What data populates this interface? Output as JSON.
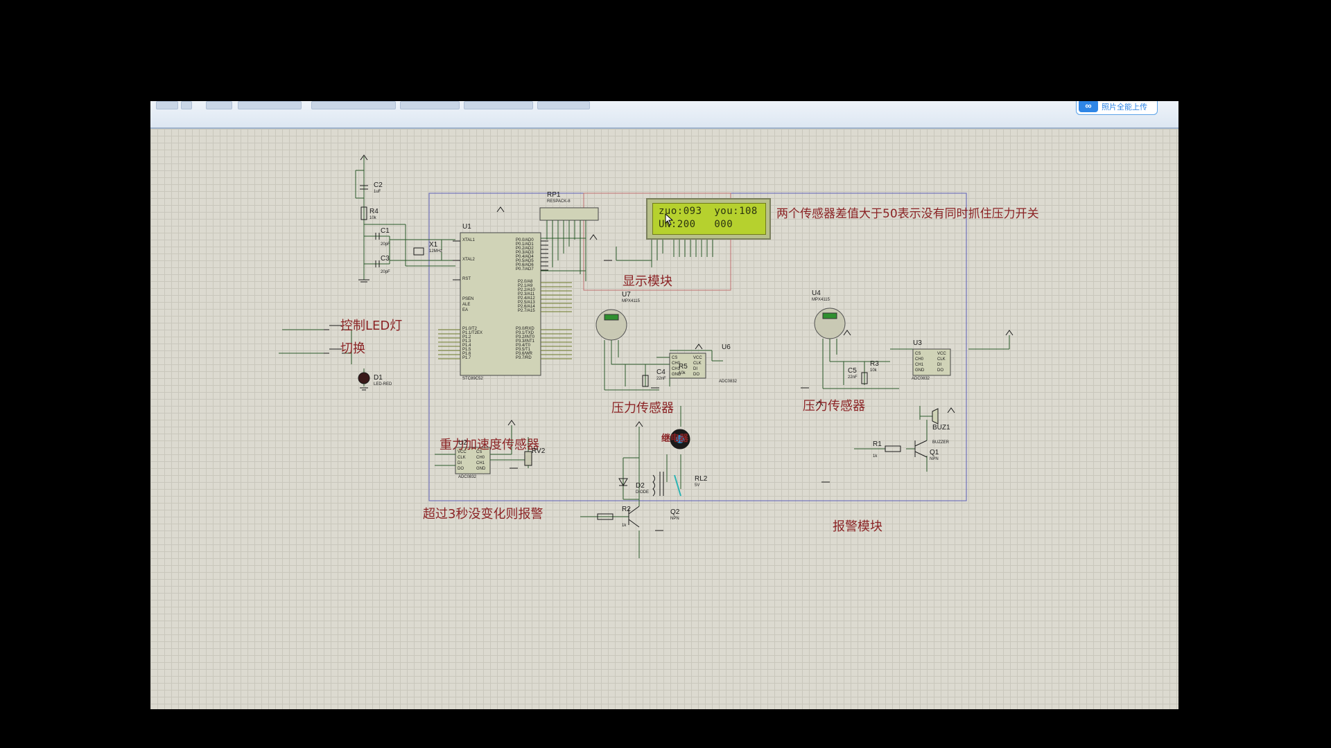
{
  "toolbar": {
    "upload_label": "照片全能上传",
    "upload_icon": "infinity-icon"
  },
  "lcd": {
    "line1": "zuo:093  you:108",
    "line2": "UN:200   000"
  },
  "annotations": {
    "diff_note": "两个传感器差值大于50表示没有同时抓住压力开关",
    "display_module": "显示模块",
    "led_control": "控制LED灯",
    "switch": "切换",
    "pressure_sensor_left": "压力传感器",
    "pressure_sensor_right": "压力传感器",
    "gravity_sensor": "重力加速度传感器",
    "timeout_alarm": "超过3秒没变化则报警",
    "relay": "继电器",
    "alarm_module": "报警模块"
  },
  "components": {
    "u1": {
      "ref": "U1",
      "type": "STC89C52"
    },
    "rp1": {
      "ref": "RP1",
      "type": "RESPACK-8"
    },
    "c1": {
      "ref": "C1",
      "value": "20pF"
    },
    "c2": {
      "ref": "C2",
      "value": "1uF"
    },
    "c3": {
      "ref": "C3",
      "value": "20pF"
    },
    "r4": {
      "ref": "R4",
      "value": "10k"
    },
    "x1": {
      "ref": "X1",
      "value": "12MHz"
    },
    "d1": {
      "ref": "D1",
      "value": "LED-RED"
    },
    "u7": {
      "ref": "U7",
      "value": "MPX4115"
    },
    "u4": {
      "ref": "U4",
      "value": "MPX4115"
    },
    "u6": {
      "ref": "U6",
      "value": "ADC0832"
    },
    "u3": {
      "ref": "U3",
      "value": "ADC0832"
    },
    "u2": {
      "ref": "U2",
      "value": "ADC0832"
    },
    "c4": {
      "ref": "C4",
      "value": "22nF"
    },
    "c5": {
      "ref": "C5",
      "value": "22nF"
    },
    "r5": {
      "ref": "R5",
      "value": "10k"
    },
    "r3": {
      "ref": "R3",
      "value": "10k"
    },
    "rv2": {
      "ref": "RV2"
    },
    "d2": {
      "ref": "D2",
      "value": "DIODE"
    },
    "rl2": {
      "ref": "RL2",
      "value": "5V"
    },
    "q2": {
      "ref": "Q2",
      "value": "NPN"
    },
    "r2": {
      "ref": "R2",
      "value": "1k"
    },
    "buz1": {
      "ref": "BUZ1",
      "value": "BUZZER"
    },
    "r1": {
      "ref": "R1",
      "value": "1k"
    },
    "q1": {
      "ref": "Q1",
      "value": "NPN"
    }
  },
  "u1_pins_left": [
    "XTAL1",
    "XTAL2",
    "RST",
    "PSEN",
    "ALE",
    "EA",
    "P1.0/T2",
    "P1.1/T2EX",
    "P1.2",
    "P1.3",
    "P1.4",
    "P1.5",
    "P1.6",
    "P1.7"
  ],
  "u1_pins_right": [
    "P0.0/AD0",
    "P0.1/AD1",
    "P0.2/AD2",
    "P0.3/AD3",
    "P0.4/AD4",
    "P0.5/AD5",
    "P0.6/AD6",
    "P0.7/AD7",
    "P2.0/A8",
    "P2.1/A9",
    "P2.2/A10",
    "P2.3/A11",
    "P2.4/A12",
    "P2.5/A13",
    "P2.6/A14",
    "P2.7/A15",
    "P3.0/RXD",
    "P3.1/TXD",
    "P3.2/INT0",
    "P3.3/INT1",
    "P3.4/T0",
    "P3.5/T1",
    "P3.6/WR",
    "P3.7/RD"
  ],
  "adc_pins_left": [
    "CS",
    "CH0",
    "CH1",
    "GND"
  ],
  "adc_pins_right": [
    "VCC",
    "CLK",
    "DI",
    "DO"
  ],
  "colors": {
    "annotation": "#8b2325",
    "wire": "#2a5a2a",
    "module_border": "#5b5fb8",
    "display_border": "#c07070",
    "chip": "#d0d3b7",
    "grid": "#c9c7bc"
  }
}
